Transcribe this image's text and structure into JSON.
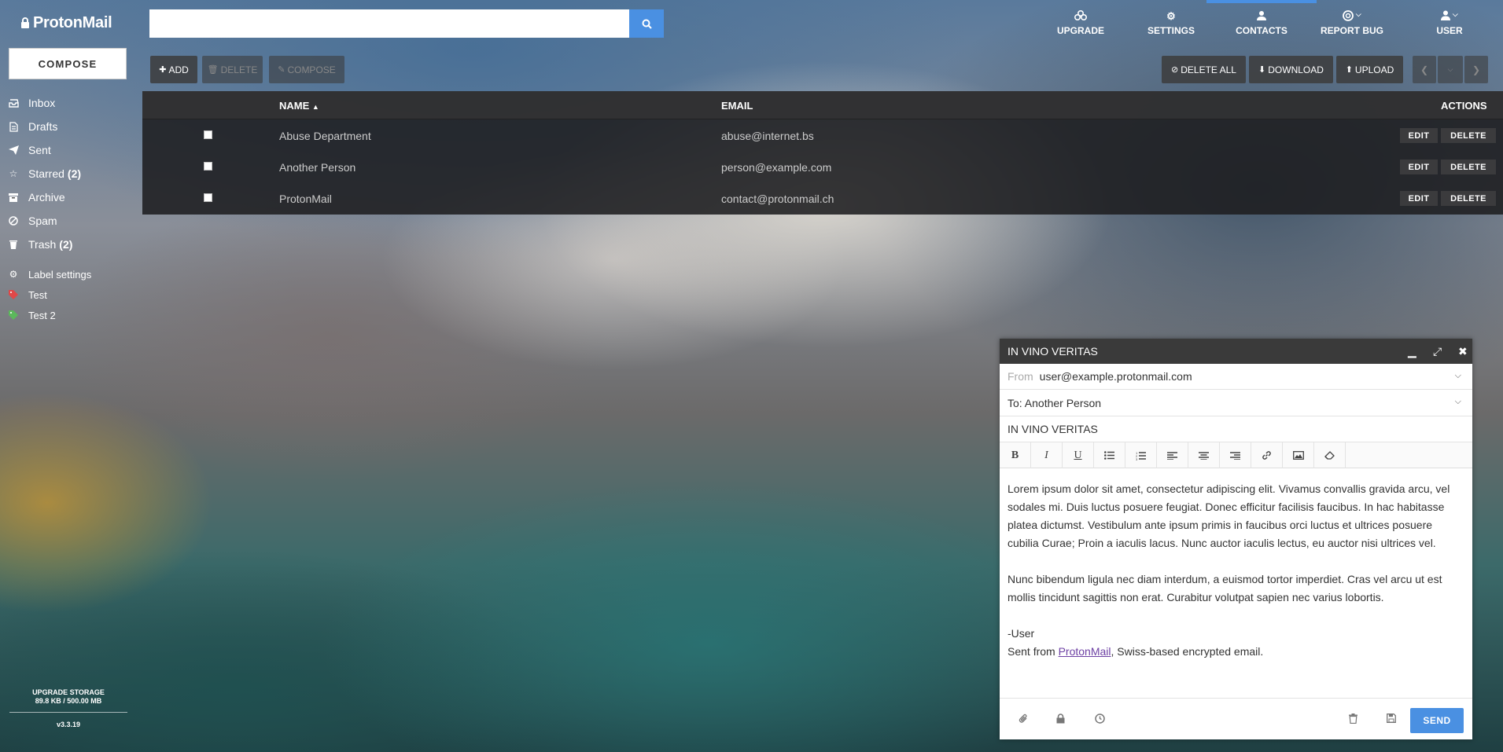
{
  "app": {
    "logo_text": "ProtonMail"
  },
  "sidebar": {
    "compose_label": "COMPOSE",
    "items": [
      {
        "label": "Inbox",
        "count": "",
        "icon": "inbox-icon"
      },
      {
        "label": "Drafts",
        "count": "",
        "icon": "drafts-icon"
      },
      {
        "label": "Sent",
        "count": "",
        "icon": "sent-icon"
      },
      {
        "label": "Starred",
        "count": "(2)",
        "icon": "star-icon"
      },
      {
        "label": "Archive",
        "count": "",
        "icon": "archive-icon"
      },
      {
        "label": "Spam",
        "count": "",
        "icon": "spam-icon"
      },
      {
        "label": "Trash",
        "count": "(2)",
        "icon": "trash-icon"
      }
    ],
    "labels": [
      {
        "label": "Label settings",
        "icon": "gear-icon",
        "color": "#ffffff"
      },
      {
        "label": "Test",
        "icon": "tag-icon",
        "color": "#e04848"
      },
      {
        "label": "Test 2",
        "icon": "tag-icon",
        "color": "#5cb85c"
      }
    ],
    "storage_label": "UPGRADE STORAGE",
    "storage_value": "89.8 KB / 500.00 MB",
    "version": "v3.3.19"
  },
  "search": {
    "placeholder": ""
  },
  "topnav": {
    "upgrade": "UPGRADE",
    "settings": "SETTINGS",
    "contacts": "CONTACTS",
    "report_bug": "REPORT BUG",
    "user": "USER"
  },
  "toolbar": {
    "add": "ADD",
    "delete": "DELETE",
    "compose": "COMPOSE",
    "delete_all": "DELETE ALL",
    "download": "DOWNLOAD",
    "upload": "UPLOAD"
  },
  "table": {
    "headers": {
      "name": "NAME",
      "email": "EMAIL",
      "actions": "ACTIONS"
    },
    "edit_label": "EDIT",
    "delete_label": "DELETE",
    "rows": [
      {
        "name": "Abuse Department",
        "email": "abuse@internet.bs"
      },
      {
        "name": "Another Person",
        "email": "person@example.com"
      },
      {
        "name": "ProtonMail",
        "email": "contact@protonmail.ch"
      }
    ]
  },
  "composer": {
    "title": "IN VINO VERITAS",
    "from_label": "From",
    "from_value": "user@example.protonmail.com",
    "to_value": "To: Another Person",
    "subject": "IN VINO VERITAS",
    "body_p1": "Lorem ipsum dolor sit amet, consectetur adipiscing elit. Vivamus convallis gravida arcu, vel sodales mi. Duis luctus posuere feugiat. Donec efficitur facilisis faucibus. In hac habitasse platea dictumst. Vestibulum ante ipsum primis in faucibus orci luctus et ultrices posuere cubilia Curae; Proin a iaculis lacus. Nunc auctor iaculis lectus, eu auctor nisi ultrices vel.",
    "body_p2": "Nunc bibendum ligula nec diam interdum, a euismod tortor imperdiet. Cras vel arcu ut est mollis tincidunt sagittis non erat. Curabitur volutpat sapien nec varius lobortis.",
    "signature_name": "-User",
    "signature_prefix": "Sent from ",
    "signature_link": "ProtonMail",
    "signature_suffix": ", Swiss-based encrypted email.",
    "send_label": "SEND"
  },
  "colors": {
    "accent": "#4a90e2"
  }
}
